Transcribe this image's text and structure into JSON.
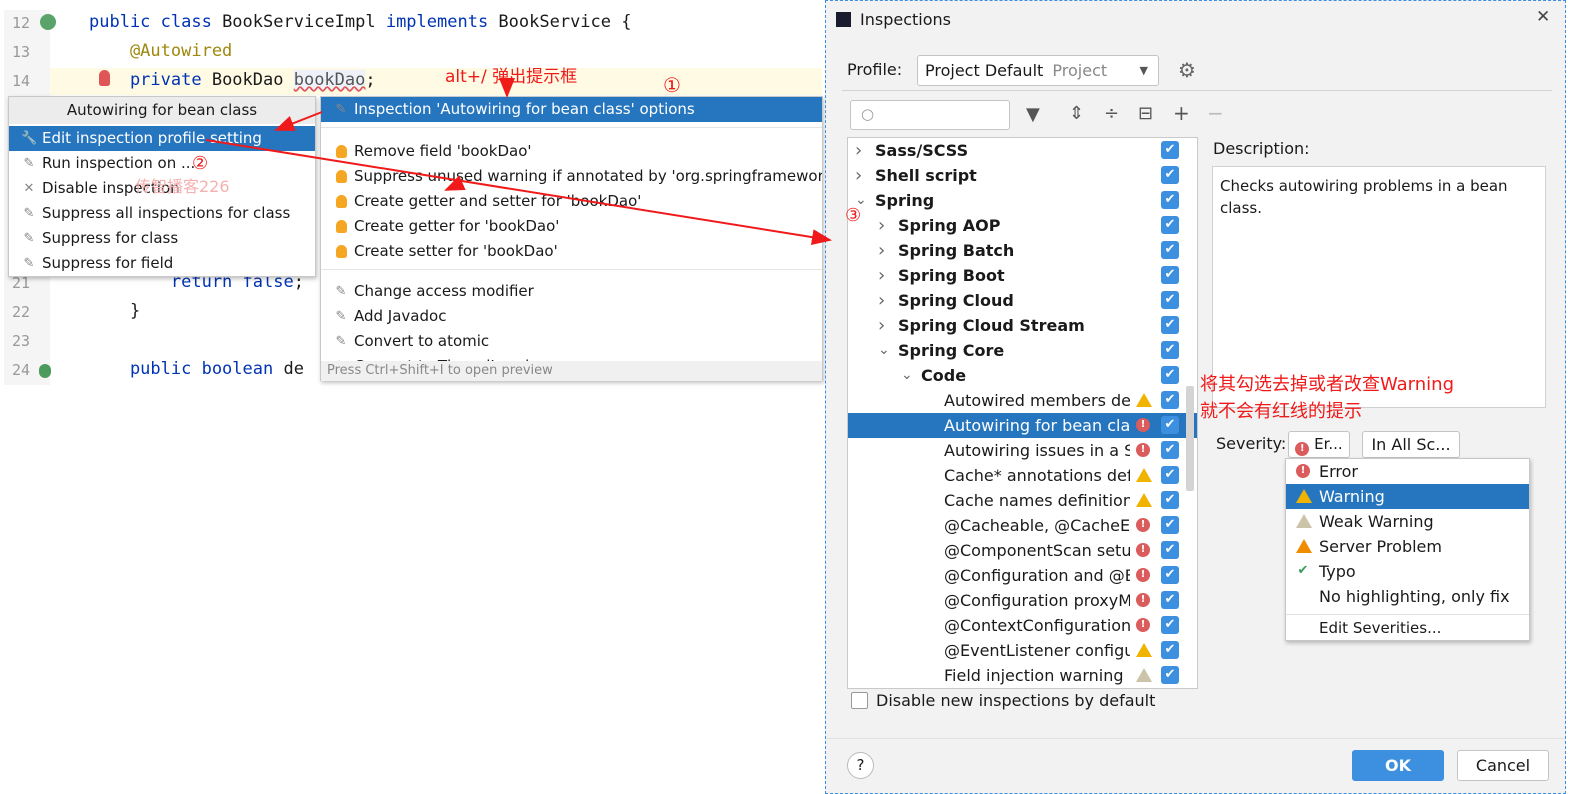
{
  "editor": {
    "lines": [
      {
        "num": "12",
        "parts": [
          [
            "kw",
            "public class "
          ],
          [
            "",
            "BookServiceImpl "
          ],
          [
            "kw",
            "implements "
          ],
          [
            "",
            "BookService {"
          ]
        ]
      },
      {
        "num": "13",
        "parts": [
          [
            "ann",
            "    @Autowired"
          ]
        ]
      },
      {
        "num": "14",
        "parts": [
          [
            "kw",
            "    private "
          ],
          [
            "",
            "BookDao "
          ],
          [
            "u",
            "bookDao"
          ],
          [
            "",
            ";"
          ]
        ]
      },
      {
        "num": "21",
        "parts": [
          [
            "kw",
            "        return false"
          ],
          [
            "",
            ";"
          ]
        ]
      },
      {
        "num": "22",
        "parts": [
          [
            "",
            "    }"
          ]
        ]
      },
      {
        "num": "23",
        "parts": []
      },
      {
        "num": "24",
        "parts": [
          [
            "kw",
            "    public boolean "
          ],
          [
            "",
            "de"
          ]
        ]
      }
    ]
  },
  "left_popup": {
    "title": "Autowiring for bean class",
    "items": [
      {
        "label": "Edit inspection profile setting",
        "icon": "wrench-icon",
        "selected": true
      },
      {
        "label": "Run inspection on ...",
        "icon": "pencil-icon"
      },
      {
        "label": "Disable inspection",
        "icon": "close-icon"
      },
      {
        "label": "Suppress all inspections for class",
        "icon": "pencil-icon"
      },
      {
        "label": "Suppress for class",
        "icon": "pencil-icon"
      },
      {
        "label": "Suppress for field",
        "icon": "pencil-icon"
      }
    ]
  },
  "right_popup": {
    "groups": [
      [
        {
          "label": "Inspection 'Autowiring for bean class' options",
          "icon": "pencil-icon",
          "selected": true
        }
      ],
      [
        {
          "label": "Remove field 'bookDao'",
          "icon": "bulb-icon"
        },
        {
          "label": "Suppress unused warning if annotated by 'org.springframework.beans.factory.annotation.Autowired'",
          "icon": "bulb-icon"
        },
        {
          "label": "Create getter and setter for 'bookDao'",
          "icon": "bulb-icon"
        },
        {
          "label": "Create getter for 'bookDao'",
          "icon": "bulb-icon"
        },
        {
          "label": "Create setter for 'bookDao'",
          "icon": "bulb-icon"
        }
      ],
      [
        {
          "label": "Change access modifier",
          "icon": "pencil-icon"
        },
        {
          "label": "Add Javadoc",
          "icon": "pencil-icon"
        },
        {
          "label": "Convert to atomic",
          "icon": "pencil-icon"
        },
        {
          "label": "Convert to ThreadLocal",
          "icon": "pencil-icon"
        }
      ]
    ],
    "footer": "Press Ctrl+Shift+I to open preview"
  },
  "dialog": {
    "title": "Inspections",
    "profile_label": "Profile:",
    "profile_value": "Project Default",
    "profile_scope": "Project",
    "search_placeholder": "",
    "tree": [
      {
        "label": "Sass/SCSS",
        "level": 0,
        "bold": true,
        "arrow": "›"
      },
      {
        "label": "Shell script",
        "level": 0,
        "bold": true,
        "arrow": "›"
      },
      {
        "label": "Spring",
        "level": 0,
        "bold": true,
        "arrow": "⌄"
      },
      {
        "label": "Spring AOP",
        "level": 1,
        "bold": true,
        "arrow": "›"
      },
      {
        "label": "Spring Batch",
        "level": 1,
        "bold": true,
        "arrow": "›"
      },
      {
        "label": "Spring Boot",
        "level": 1,
        "bold": true,
        "arrow": "›"
      },
      {
        "label": "Spring Cloud",
        "level": 1,
        "bold": true,
        "arrow": "›"
      },
      {
        "label": "Spring Cloud Stream",
        "level": 1,
        "bold": true,
        "arrow": "›"
      },
      {
        "label": "Spring Core",
        "level": 1,
        "bold": true,
        "arrow": "⌄"
      },
      {
        "label": "Code",
        "level": 2,
        "bold": true,
        "arrow": "⌄"
      },
      {
        "label": "Autowired members defi",
        "level": 3,
        "sev": "warning"
      },
      {
        "label": "Autowiring for bean clas",
        "level": 3,
        "sev": "error",
        "selected": true
      },
      {
        "label": "Autowiring issues in a Sp",
        "level": 3,
        "sev": "error"
      },
      {
        "label": "Cache* annotations defi",
        "level": 3,
        "sev": "warning"
      },
      {
        "label": "Cache names definition",
        "level": 3,
        "sev": "warning"
      },
      {
        "label": "@Cacheable, @CacheEv",
        "level": 3,
        "sev": "error"
      },
      {
        "label": "@ComponentScan setup",
        "level": 3,
        "sev": "error"
      },
      {
        "label": "@Configuration and @B",
        "level": 3,
        "sev": "error"
      },
      {
        "label": "@Configuration proxyM",
        "level": 3,
        "sev": "error"
      },
      {
        "label": "@ContextConfiguration",
        "level": 3,
        "sev": "error"
      },
      {
        "label": "@EventListener configur",
        "level": 3,
        "sev": "warning"
      },
      {
        "label": "Field injection warning",
        "level": 3,
        "sev": "weak"
      }
    ],
    "description_label": "Description:",
    "description": "Checks autowiring problems in a bean class.",
    "severity_label": "Severity:",
    "severity_value": "Er...",
    "scope_value": "In All Sc...",
    "severity_options": [
      {
        "label": "Error",
        "sev": "error"
      },
      {
        "label": "Warning",
        "sev": "warning",
        "selected": true
      },
      {
        "label": "Weak Warning",
        "sev": "weak"
      },
      {
        "label": "Server Problem",
        "sev": "server"
      },
      {
        "label": "Typo",
        "sev": "typo"
      },
      {
        "label": "No highlighting, only fix",
        "sev": "none"
      }
    ],
    "edit_severities": "Edit Severities...",
    "disable_new_label": "Disable new inspections by default",
    "ok": "OK",
    "cancel": "Cancel",
    "help": "?"
  },
  "annotations": {
    "shortcut": "alt+/  弹出提示框",
    "step1": "①",
    "step2": "②",
    "step3": "③",
    "watermark": "传智播客226",
    "note_line1": "将其勾选去掉或者改查Warning",
    "note_line2": "就不会有红线的提示"
  },
  "colors": {
    "selection": "#2675bf",
    "annotation": "#f01a1a",
    "checkbox": "#3d8fe0",
    "error": "#db5c5c",
    "warning": "#f0b400"
  }
}
